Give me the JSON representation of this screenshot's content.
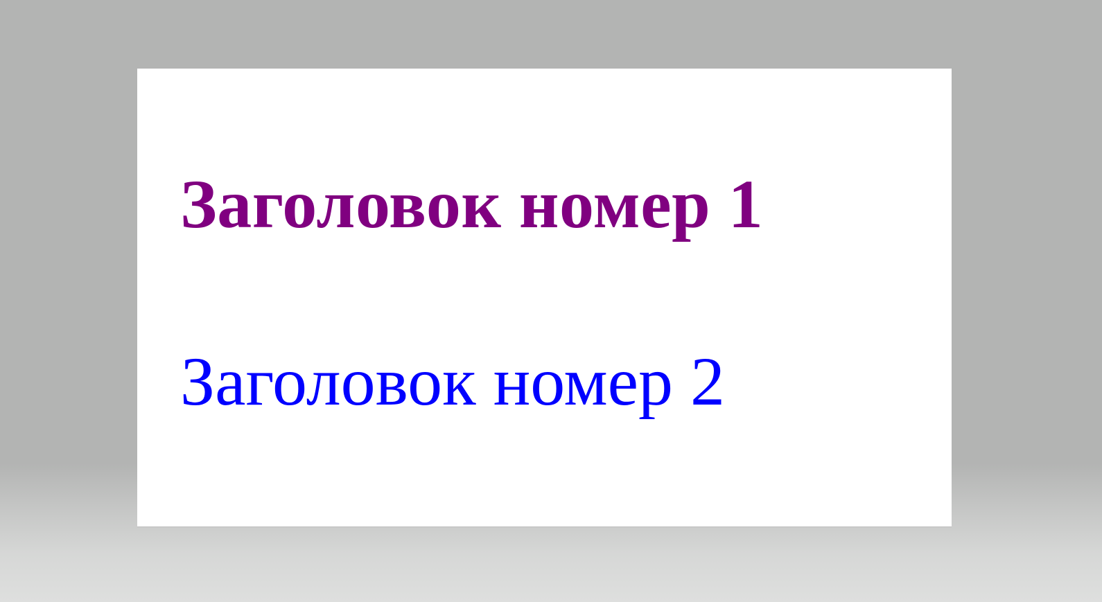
{
  "headings": [
    {
      "text": "Заголовок номер 1",
      "color": "#800080"
    },
    {
      "text": "Заголовок номер 2",
      "color": "#0000ff"
    }
  ]
}
